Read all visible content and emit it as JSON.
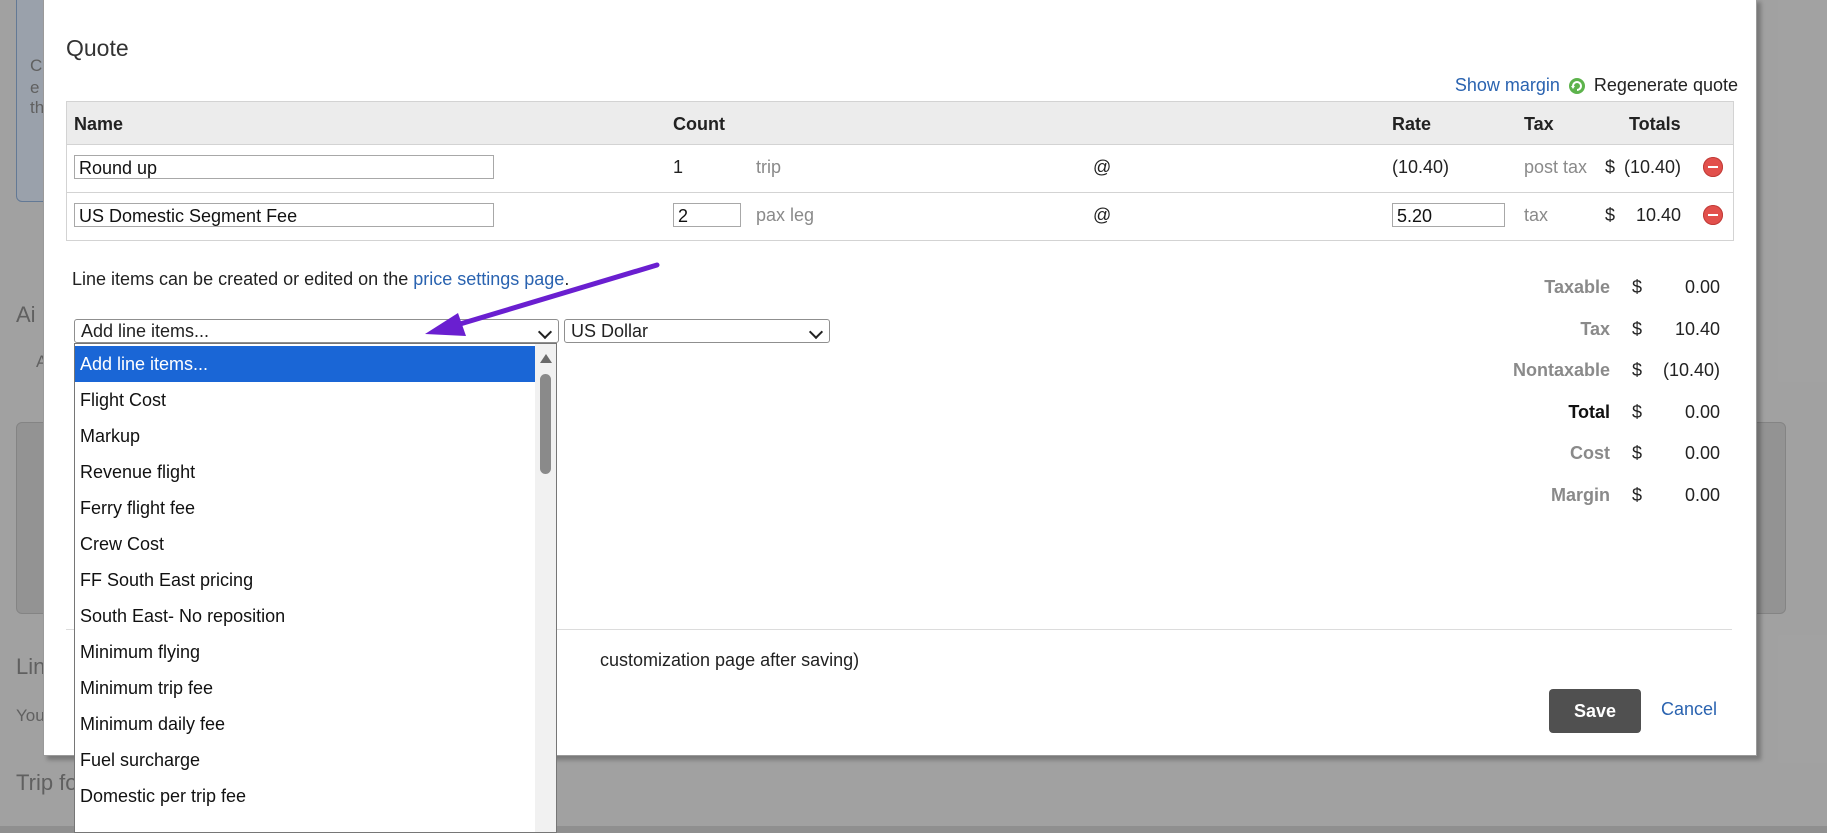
{
  "background": {
    "left_texts": [
      "C",
      "e",
      "th",
      "Ai",
      "A",
      "Lin",
      "You",
      "Trip fo"
    ]
  },
  "modal": {
    "title": "Quote",
    "show_margin": "Show margin",
    "refresh_icon": "refresh-icon",
    "regenerate": "Regenerate quote",
    "columns": [
      "Name",
      "Count",
      "Rate",
      "Tax",
      "Totals"
    ],
    "rows": [
      {
        "name": "Round up",
        "count": "1",
        "unit": "trip",
        "at": "@",
        "rate": "(10.40)",
        "tax": "post tax",
        "cur": "$",
        "total": "(10.40)"
      },
      {
        "name": "US Domestic Segment Fee",
        "count": "2",
        "unit": "pax leg",
        "at": "@",
        "rate": "5.20",
        "tax": "tax",
        "cur": "$",
        "total": "10.40"
      }
    ],
    "note_prefix": "Line items can be created or edited on the ",
    "note_link": "price settings page",
    "note_suffix": ".",
    "add_select_value": "Add line items...",
    "currency_select_value": "US Dollar",
    "totals": [
      {
        "label": "Taxable",
        "cur": "$",
        "value": "0.00",
        "bold": false
      },
      {
        "label": "Tax",
        "cur": "$",
        "value": "10.40",
        "bold": false
      },
      {
        "label": "Nontaxable",
        "cur": "$",
        "value": "(10.40)",
        "bold": false
      },
      {
        "label": "Total",
        "cur": "$",
        "value": "0.00",
        "bold": true
      },
      {
        "label": "Cost",
        "cur": "$",
        "value": "0.00",
        "bold": false
      },
      {
        "label": "Margin",
        "cur": "$",
        "value": "0.00",
        "bold": false
      }
    ],
    "customization_text": "customization page after saving)",
    "save": "Save",
    "cancel": "Cancel"
  },
  "dropdown": {
    "selected_index": 0,
    "options": [
      "Add line items...",
      "Flight Cost",
      "Markup",
      "Revenue flight",
      "Ferry flight fee",
      "Crew Cost",
      "FF South East pricing",
      "South East- No reposition",
      "Minimum flying",
      "Minimum trip fee",
      "Minimum daily fee",
      "Fuel surcharge",
      "Domestic per trip fee"
    ]
  },
  "colors": {
    "link": "#2a63b0",
    "selected": "#1a66d6",
    "arrow": "#6a1fd0",
    "danger": "#e2504c",
    "save_bg": "#505050"
  }
}
